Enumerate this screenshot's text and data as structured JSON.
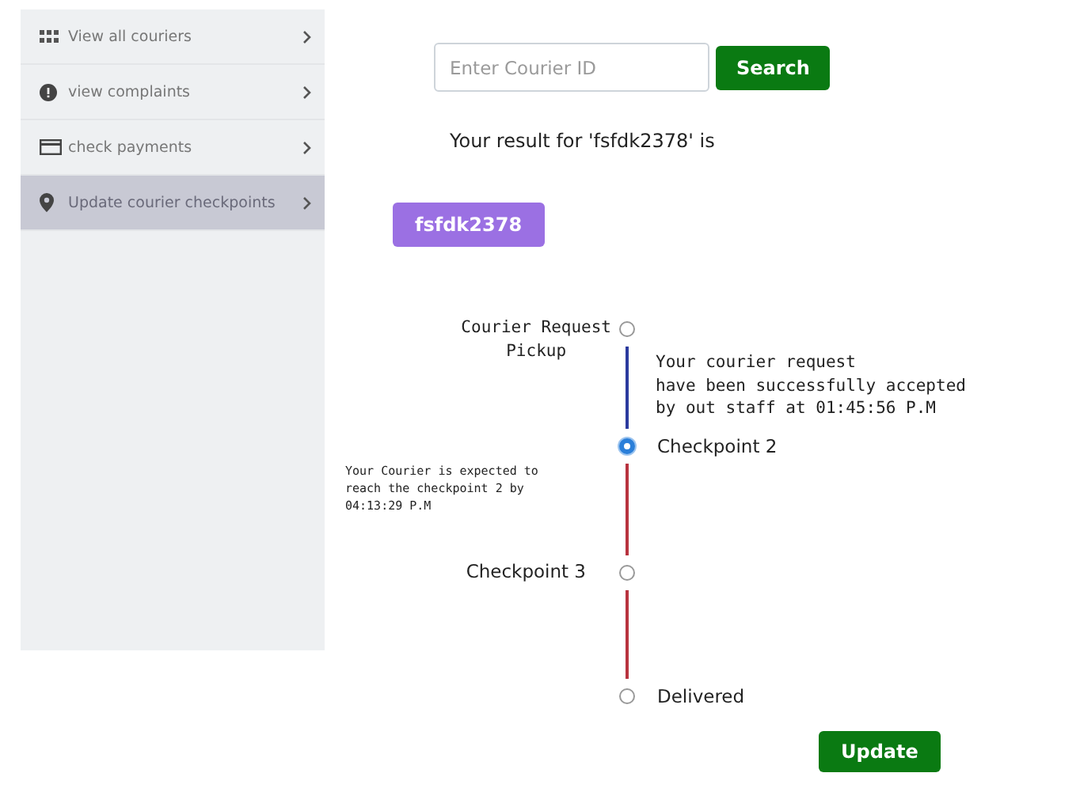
{
  "sidebar": {
    "items": [
      {
        "label": "View all couriers",
        "selected": false
      },
      {
        "label": "view complaints",
        "selected": false
      },
      {
        "label": "check payments",
        "selected": false
      },
      {
        "label": "Update courier checkpoints",
        "selected": true
      }
    ]
  },
  "search": {
    "placeholder": "Enter Courier ID",
    "button": "Search"
  },
  "result_text": "Your result for 'fsfdk2378' is",
  "courier_id": "fsfdk2378",
  "timeline": [
    {
      "label": "Courier Request\nPickup",
      "kind": "request",
      "selected": false,
      "segment": {
        "color": "#2b3a9e",
        "note": "Your courier request\nhave been successfully accepted\nby out staff at 01:45:56 P.M"
      }
    },
    {
      "label": "Checkpoint 2",
      "kind": "checkpoint",
      "selected": true,
      "segment": {
        "color": "#b8333f",
        "note": "Your Courier is expected to\nreach the checkpoint 2 by\n04:13:29 P.M"
      }
    },
    {
      "label": "Checkpoint 3",
      "kind": "checkpoint",
      "selected": false,
      "segment": {
        "color": "#b8333f"
      }
    },
    {
      "label": "Delivered",
      "kind": "checkpoint",
      "selected": false
    }
  ],
  "update_button": "Update"
}
